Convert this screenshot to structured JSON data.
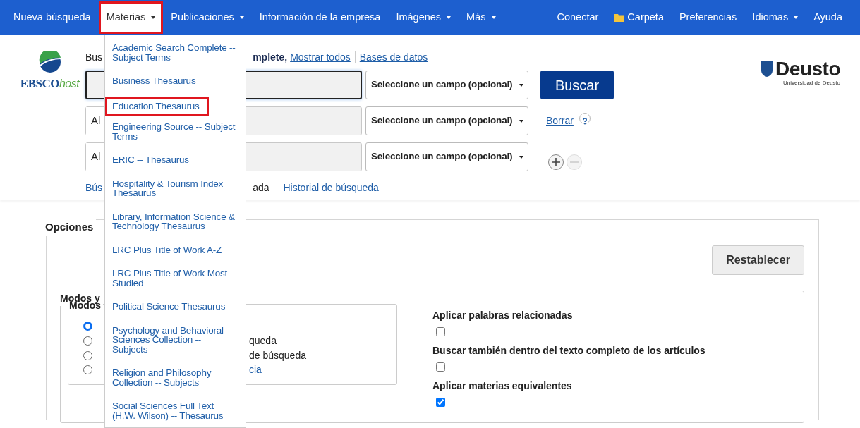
{
  "nav": {
    "left": [
      {
        "label": "Nueva búsqueda",
        "kind": "link",
        "open": false
      },
      {
        "label": "Materias",
        "kind": "menu",
        "open": true
      },
      {
        "label": "Publicaciones",
        "kind": "menu",
        "open": false
      },
      {
        "label": "Información de la empresa",
        "kind": "link",
        "open": false
      },
      {
        "label": "Imágenes",
        "kind": "menu",
        "open": false
      },
      {
        "label": "Más",
        "kind": "menu",
        "open": false
      }
    ],
    "right": [
      {
        "label": "Conectar",
        "kind": "link",
        "open": false
      },
      {
        "label": "Carpeta",
        "kind": "folder",
        "open": false
      },
      {
        "label": "Preferencias",
        "kind": "link",
        "open": false
      },
      {
        "label": "Idiomas",
        "kind": "menu",
        "open": false
      },
      {
        "label": "Ayuda",
        "kind": "link",
        "open": false
      }
    ]
  },
  "logo": {
    "brand": "EBSCO",
    "suffix": "host"
  },
  "searching": {
    "prefix": "Bus",
    "database": "mplete,",
    "show_all": "Mostrar todos",
    "databases": "Bases de datos"
  },
  "search_rows": [
    {
      "kind": "first",
      "focused": true,
      "field": "Seleccione un campo (opcional)"
    },
    {
      "kind": "boolean",
      "operator": "Al",
      "focused": false,
      "field": "Seleccione un campo (opcional)"
    },
    {
      "kind": "boolean",
      "operator": "Al",
      "focused": false,
      "field": "Seleccione un campo (opcional)"
    }
  ],
  "search_button": "Buscar",
  "clear": "Borrar",
  "row_buttons": {
    "add_disabled": false,
    "remove_disabled": true
  },
  "links": [
    {
      "text": "Bús",
      "kind": "link"
    },
    {
      "text": "ada",
      "kind": "text"
    },
    {
      "text": "Historial de búsqueda",
      "kind": "link"
    }
  ],
  "institution": {
    "name": "Deusto",
    "subtitle": "Universidad de Deusto"
  },
  "options": {
    "title": "Opciones",
    "reset": "Restablecer",
    "group_title": "Modos y",
    "modes_title": "Modos",
    "modes": [
      {
        "selected": true
      },
      {
        "selected": false,
        "text": "queda",
        "kind": "text"
      },
      {
        "selected": false,
        "text": "de búsqueda",
        "kind": "text"
      },
      {
        "selected": false,
        "text": "cia",
        "kind": "link"
      }
    ],
    "checks": [
      {
        "label": "Aplicar palabras relacionadas",
        "checked": false
      },
      {
        "label": "Buscar también dentro del texto completo de los artículos",
        "checked": false
      },
      {
        "label": "Aplicar materias equivalentes",
        "checked": true
      }
    ]
  },
  "menu": {
    "items": [
      {
        "label": "Academic Search Complete -- Subject Terms",
        "highlighted": false
      },
      {
        "label": "Business Thesaurus",
        "highlighted": false
      },
      {
        "label": "Education Thesaurus",
        "highlighted": true
      },
      {
        "label": "Engineering Source -- Subject Terms",
        "highlighted": false
      },
      {
        "label": "ERIC -- Thesaurus",
        "highlighted": false
      },
      {
        "label": "Hospitality & Tourism Index Thesaurus",
        "highlighted": false
      },
      {
        "label": "Library, Information Science & Technology Thesaurus",
        "highlighted": false
      },
      {
        "label": "LRC Plus Title of Work A-Z",
        "highlighted": false
      },
      {
        "label": "LRC Plus Title of Work Most Studied",
        "highlighted": false
      },
      {
        "label": "Political Science Thesaurus",
        "highlighted": false
      },
      {
        "label": "Psychology and Behavioral Sciences Collection -- Subjects",
        "highlighted": false
      },
      {
        "label": "Religion and Philosophy Collection -- Subjects",
        "highlighted": false
      },
      {
        "label": "Social Sciences Full Text (H.W. Wilson) -- Thesaurus",
        "highlighted": false
      }
    ]
  }
}
